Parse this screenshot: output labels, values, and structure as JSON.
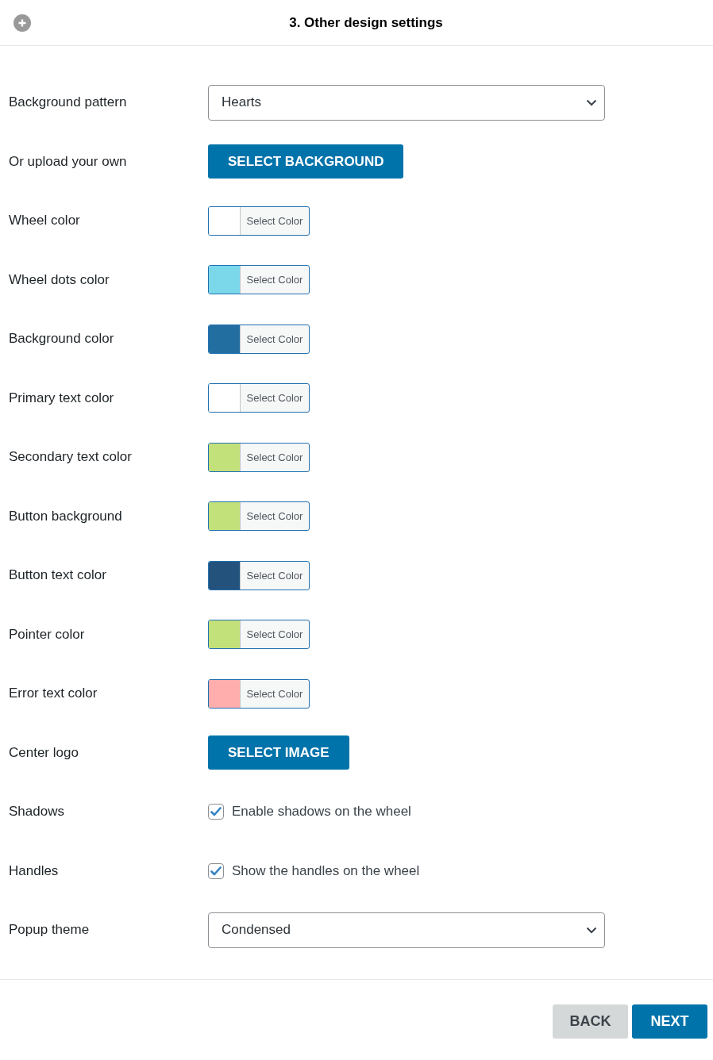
{
  "header": {
    "title": "3. Other design settings"
  },
  "settings": [
    {
      "kind": "select",
      "label": "Background pattern",
      "value": "Hearts"
    },
    {
      "kind": "button",
      "label": "Or upload your own",
      "button": "SELECT BACKGROUND"
    },
    {
      "kind": "color",
      "label": "Wheel color",
      "button": "Select Color",
      "color": "#ffffff"
    },
    {
      "kind": "color",
      "label": "Wheel dots color",
      "button": "Select Color",
      "color": "#7bd7ea"
    },
    {
      "kind": "color",
      "label": "Background color",
      "button": "Select Color",
      "color": "#226ea1"
    },
    {
      "kind": "color",
      "label": "Primary text color",
      "button": "Select Color",
      "color": "#ffffff"
    },
    {
      "kind": "color",
      "label": "Secondary text color",
      "button": "Select Color",
      "color": "#c3e17a"
    },
    {
      "kind": "color",
      "label": "Button background",
      "button": "Select Color",
      "color": "#c3e17a"
    },
    {
      "kind": "color",
      "label": "Button text color",
      "button": "Select Color",
      "color": "#23527c"
    },
    {
      "kind": "color",
      "label": "Pointer color",
      "button": "Select Color",
      "color": "#c3e17a"
    },
    {
      "kind": "color",
      "label": "Error text color",
      "button": "Select Color",
      "color": "#ffadad"
    },
    {
      "kind": "button",
      "label": "Center logo",
      "button": "SELECT IMAGE"
    },
    {
      "kind": "checkbox",
      "label": "Shadows",
      "text": "Enable shadows on the wheel",
      "checked": true
    },
    {
      "kind": "checkbox",
      "label": "Handles",
      "text": "Show the handles on the wheel",
      "checked": true
    },
    {
      "kind": "select",
      "label": "Popup theme",
      "value": "Condensed"
    }
  ],
  "footer": {
    "buttons": [
      {
        "kind": "secondary",
        "label": "BACK"
      },
      {
        "kind": "primary",
        "label": "NEXT"
      }
    ]
  }
}
